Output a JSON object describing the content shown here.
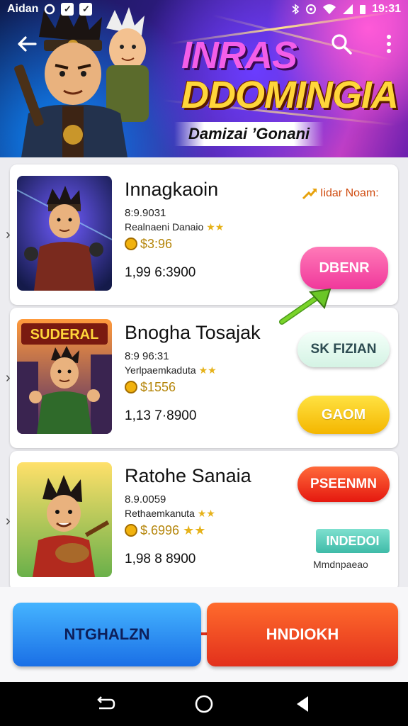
{
  "status_bar": {
    "left_text": "Aidan",
    "time": "19:31"
  },
  "header": {
    "title_line1": "INRAS",
    "title_line2": "DDOMINGIA",
    "subtitle": "Damizai ʼGonani"
  },
  "cards": [
    {
      "title": "Innagkaoin",
      "code": "8:9.9031",
      "rating_text": "Realnaeni Danaio",
      "price": "$3:96",
      "count": "1,99 6:3900",
      "link_label": "Iidar Noam:",
      "button_label": "DBENR"
    },
    {
      "title": "Bnogha Tosajak",
      "code": "8:9 96:31",
      "rating_text": "Yerlpaemkaduta",
      "price": "$1556",
      "count": "1,13 7·8900",
      "thumb_banner": "SUDERAL",
      "button1_label": "SK FIZIAN",
      "button2_label": "GAOM"
    },
    {
      "title": "Ratohe Sanaia",
      "code": "8.9.0059",
      "rating_text": "Rethaemkanuta",
      "price": "$.6996",
      "count": "1,98 8 8900",
      "button_label": "PSEENMN",
      "badge_label": "INDEDOI",
      "badge_sub": "Mmdnpaeao"
    }
  ],
  "bottom": {
    "left_button": "NTGHALZN",
    "right_button": "HNDIOKH"
  },
  "colors": {
    "pink": "#f0389b",
    "orange_red": "#e2301c",
    "blue": "#1a6fe6",
    "yellow": "#f4b600",
    "teal": "#3fbba8"
  }
}
